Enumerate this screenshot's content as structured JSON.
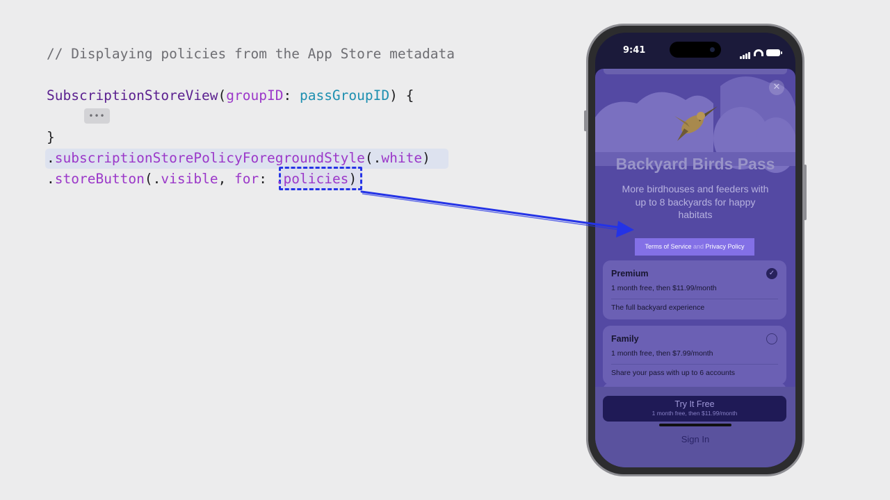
{
  "code": {
    "comment": "// Displaying policies from the App Store metadata",
    "line2": {
      "func": "SubscriptionStoreView",
      "paren_open": "(",
      "param": "groupID",
      "colon": ": ",
      "arg": "passGroupID",
      "tail": ") {"
    },
    "ellipsis": "•••",
    "closing_brace": "}",
    "line4": {
      "dot": ".",
      "modifier": "subscriptionStorePolicyForegroundStyle",
      "paren_open": "(.",
      "value": "white",
      "paren_close": ")"
    },
    "line5": {
      "dot": ".",
      "modifier": "storeButton",
      "paren_open": "(.",
      "value": "visible",
      "comma": ", ",
      "keyword": "for",
      "colon": ": ",
      "value2": ".policies",
      "paren_close": ")"
    }
  },
  "phone": {
    "status_time": "9:41",
    "title": "Backyard Birds Pass",
    "subtitle": "More birdhouses and feeders with up to 8 backyards for happy habitats",
    "policies": {
      "terms": "Terms of Service",
      "and": " and ",
      "privacy": "Privacy Policy"
    },
    "plans": [
      {
        "name": "Premium",
        "price": "1 month free, then $11.99/month",
        "description": "The full backyard experience",
        "selected": true
      },
      {
        "name": "Family",
        "price": "1 month free, then $7.99/month",
        "description": "Share your pass with up to 6 accounts",
        "selected": false
      }
    ],
    "try_button": {
      "label": "Try It Free",
      "sub": "1 month free, then $11.99/month"
    },
    "sign_in": "Sign In"
  },
  "colors": {
    "highlight": "#2433e6",
    "sheet": "#5449a3",
    "policy_chip": "#8370e6"
  }
}
